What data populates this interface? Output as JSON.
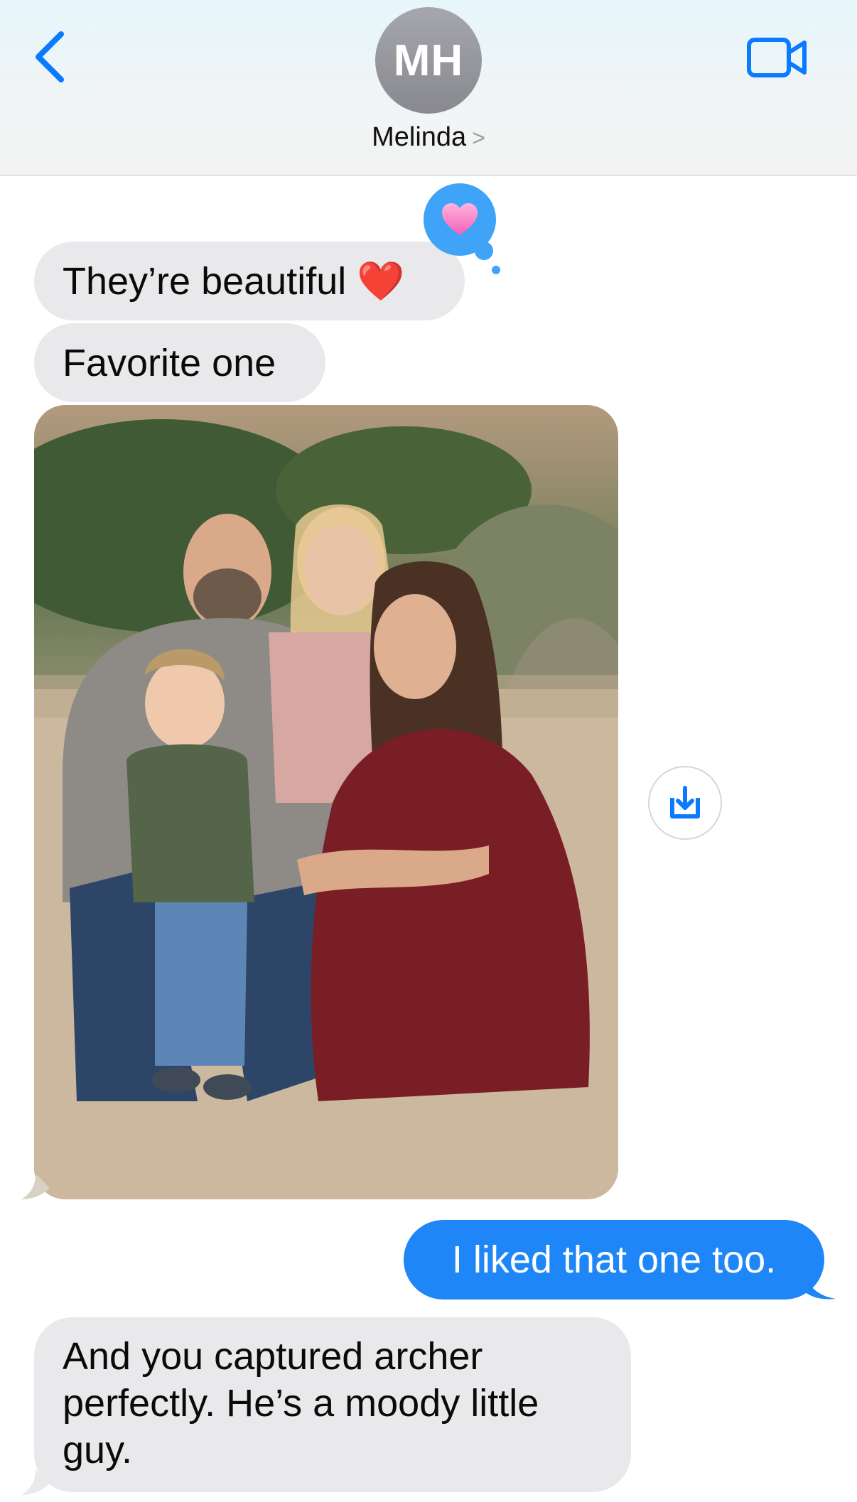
{
  "header": {
    "avatar_initials": "MH",
    "contact_name": "Melinda",
    "name_chevron": ">"
  },
  "messages": [
    {
      "direction": "received",
      "text": "They’re beautiful ❤️",
      "reaction": "heart"
    },
    {
      "direction": "received",
      "text": "Favorite one"
    },
    {
      "direction": "received",
      "type": "photo",
      "description_icon": "family-photo"
    },
    {
      "direction": "sent",
      "text": "I liked that one too."
    },
    {
      "direction": "received",
      "text": "And you captured archer perfectly. He’s a moody little guy."
    }
  ],
  "colors": {
    "sent_bubble": "#1e86f6",
    "received_bubble": "#e9e9eb",
    "accent": "#0a7aff",
    "reaction": "#3fa3f7"
  },
  "icons": {
    "back": "chevron-left-icon",
    "video": "video-camera-icon",
    "save": "save-download-icon",
    "reaction": "heart-icon"
  }
}
